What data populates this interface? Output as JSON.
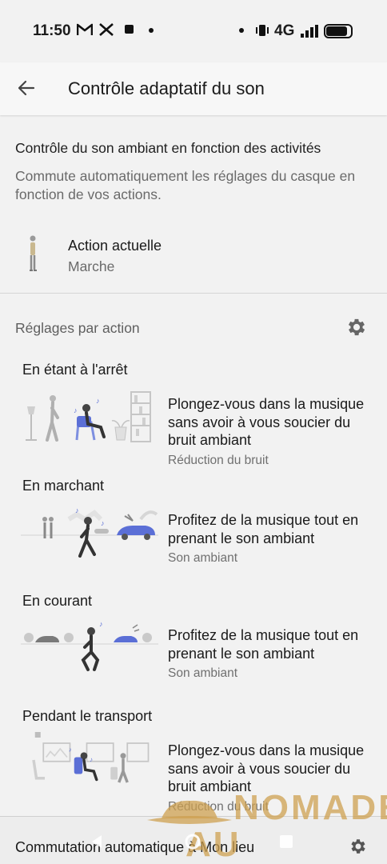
{
  "status_bar": {
    "time": "11:50",
    "notif_icons": [
      "gmail-icon",
      "x-icon",
      "app-icon",
      "dot-icon"
    ],
    "network": "4G",
    "icons": [
      "dot-icon",
      "vibrate-icon",
      "signal-icon",
      "battery-icon"
    ]
  },
  "app_bar": {
    "title": "Contrôle adaptatif du son",
    "back_icon": "back-arrow-icon"
  },
  "intro": {
    "heading": "Contrôle du son ambiant en fonction des activités",
    "description": "Commute automatiquement les réglages du casque en fonction de vos actions."
  },
  "current_action": {
    "label": "Action actuelle",
    "value": "Marche"
  },
  "settings": {
    "title": "Réglages par action",
    "gear_icon": "gear-icon",
    "actions": [
      {
        "title": "En étant à l'arrêt",
        "description": "Plongez-vous dans la musique sans avoir à vous soucier du bruit ambiant",
        "mode": "Réduction du bruit"
      },
      {
        "title": "En marchant",
        "description": "Profitez de la musique tout en prenant le son ambiant",
        "mode": "Son ambiant"
      },
      {
        "title": "En courant",
        "description": "Profitez de la musique tout en prenant le son ambiant",
        "mode": "Son ambiant"
      },
      {
        "title": "Pendant le transport",
        "description": "Plongez-vous dans la musique sans avoir à vous soucier du bruit ambiant",
        "mode": "Réduction du bruit"
      }
    ]
  },
  "bottom": {
    "label": "Commutation automatique à Mon lieu"
  },
  "watermark": {
    "line1": "NOMADE",
    "line2": "AU URBAIN"
  },
  "colors": {
    "background": "#f2f2f2",
    "text_primary": "#1a1a1a",
    "text_secondary": "#6a6a6a",
    "illustration_blue": "#5b6fd6",
    "illustration_gray": "#b5b5b5"
  }
}
